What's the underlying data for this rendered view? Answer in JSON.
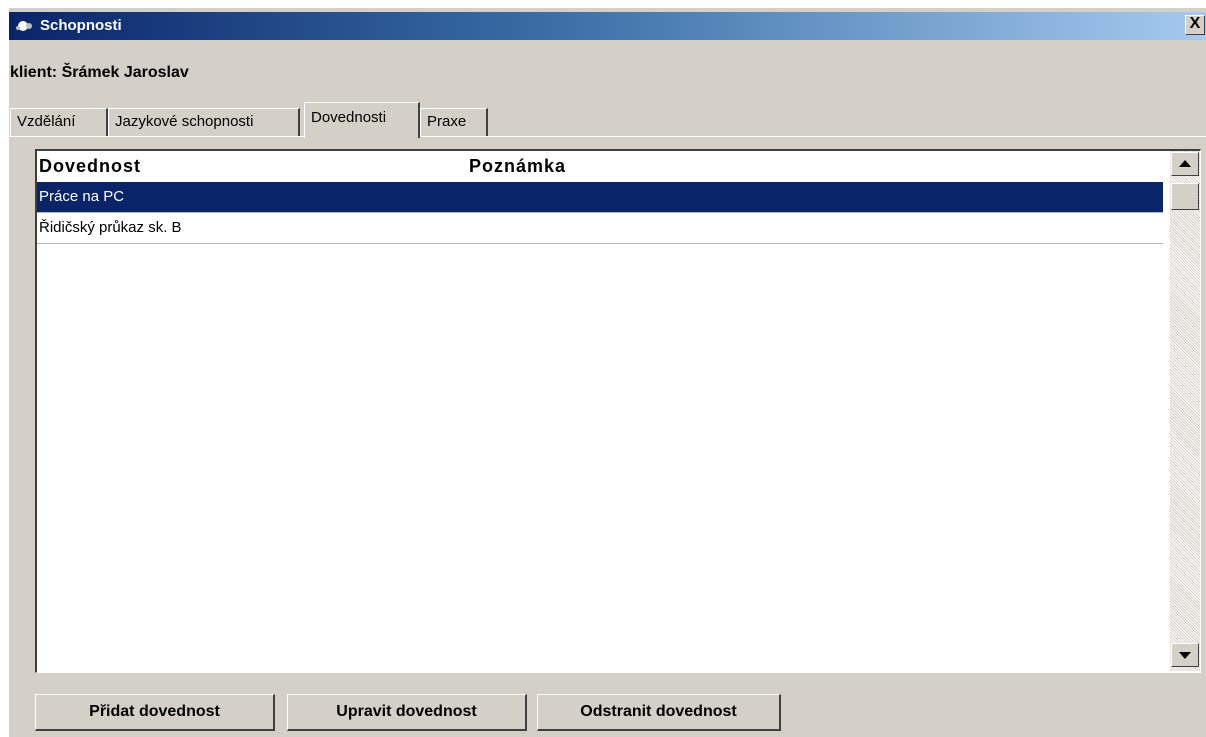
{
  "window": {
    "title": "Schopnosti",
    "close_label": "X"
  },
  "client_label": "klient: Šrámek Jaroslav",
  "tabs": [
    {
      "label": "Vzdělání",
      "active": false
    },
    {
      "label": "Jazykové schopnosti",
      "active": false
    },
    {
      "label": "Dovednosti",
      "active": true
    },
    {
      "label": "Praxe",
      "active": false
    }
  ],
  "table": {
    "columns": [
      "Dovednost",
      "Poznámka"
    ],
    "rows": [
      {
        "dovednost": "Práce na PC",
        "poznamka": "",
        "selected": true
      },
      {
        "dovednost": "Řidičský průkaz sk. B",
        "poznamka": "",
        "selected": false
      }
    ]
  },
  "buttons": {
    "add": "Přidat dovednost",
    "edit": "Upravit dovednost",
    "remove": "Odstranit dovednost"
  },
  "colors": {
    "titlebar_start": "#0a246a",
    "titlebar_end": "#a6caf0",
    "selection": "#0a246a",
    "face": "#d4d0c8"
  },
  "icons": {
    "app": "app-icon",
    "close": "close-icon",
    "scroll_up": "arrow-up-icon",
    "scroll_down": "arrow-down-icon"
  }
}
